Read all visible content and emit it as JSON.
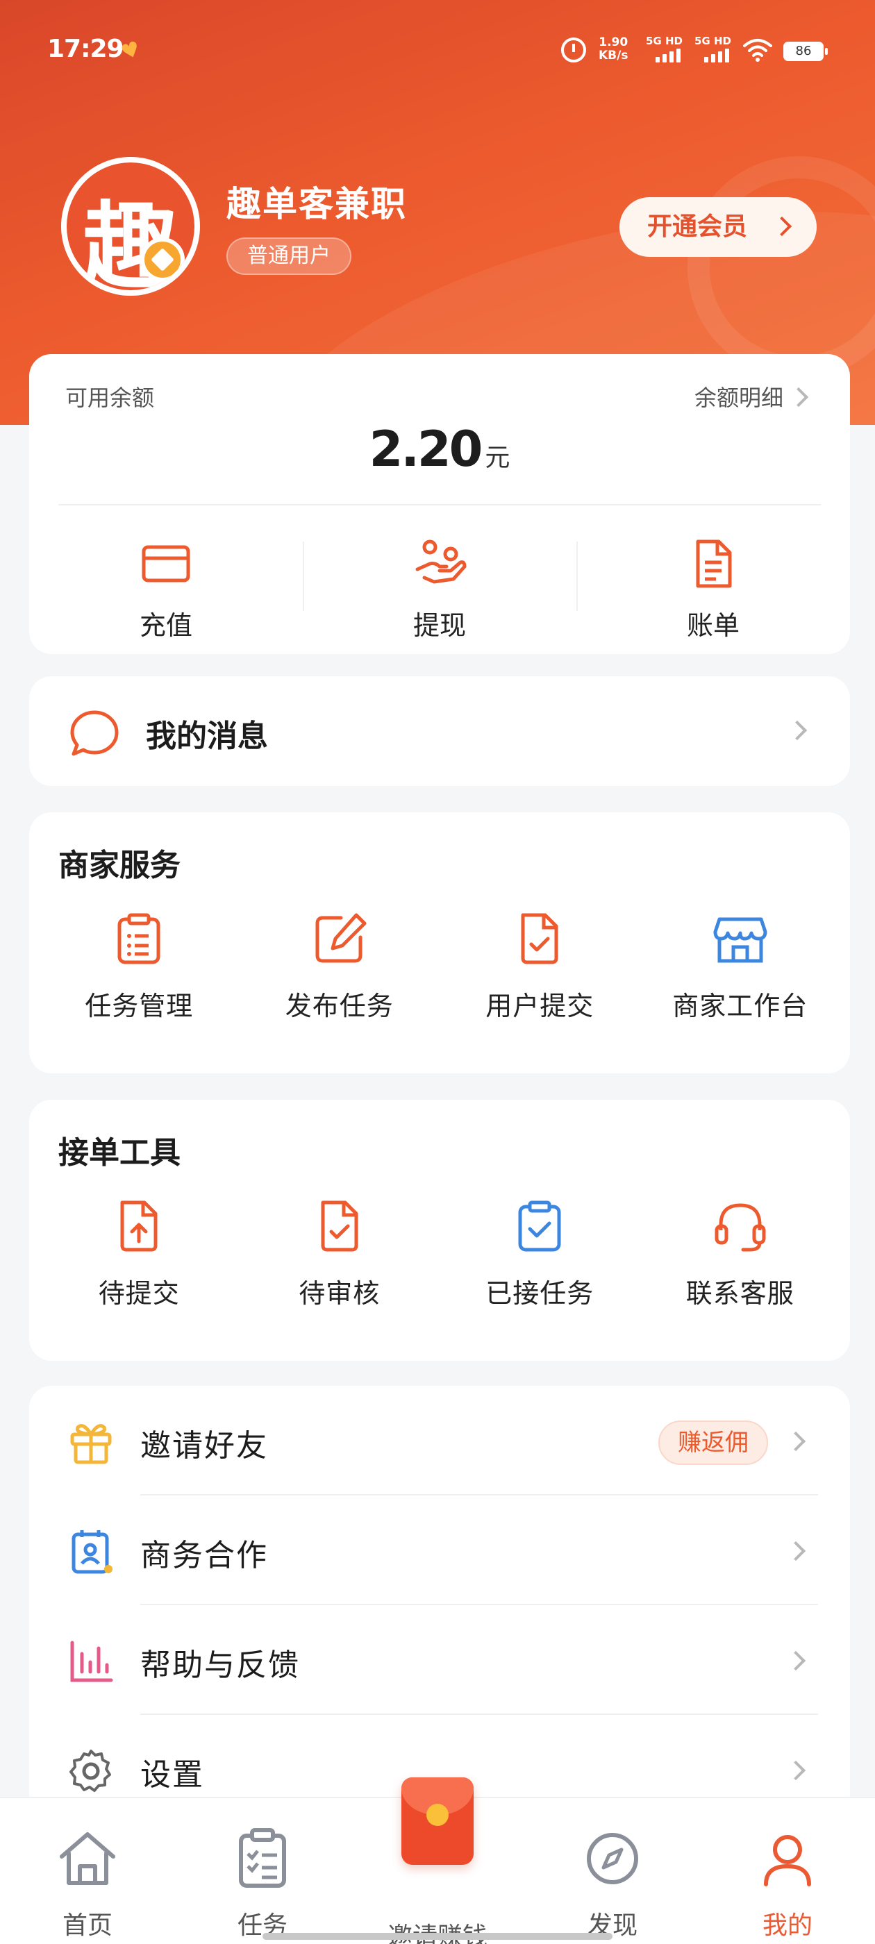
{
  "status_bar": {
    "time": "17:29",
    "speed_value": "1.90",
    "speed_unit": "KB/s",
    "net1": "5G HD",
    "net2": "5G HD",
    "battery": "86"
  },
  "profile": {
    "avatar_char": "趣",
    "name": "趣单客兼职",
    "tag": "普通用户",
    "vip_button": "开通会员"
  },
  "balance": {
    "label": "可用余额",
    "detail_link": "余额明细",
    "amount": "2.20",
    "unit": "元",
    "actions": [
      {
        "label": "充值",
        "icon": "card-icon"
      },
      {
        "label": "提现",
        "icon": "hand-coin-icon"
      },
      {
        "label": "账单",
        "icon": "document-icon"
      }
    ]
  },
  "messages": {
    "label": "我的消息"
  },
  "merchant_services": {
    "title": "商家服务",
    "items": [
      {
        "label": "任务管理",
        "icon": "clipboard-list-icon"
      },
      {
        "label": "发布任务",
        "icon": "edit-icon"
      },
      {
        "label": "用户提交",
        "icon": "file-check-icon"
      },
      {
        "label": "商家工作台",
        "icon": "store-icon"
      }
    ]
  },
  "order_tools": {
    "title": "接单工具",
    "items": [
      {
        "label": "待提交",
        "icon": "file-upload-icon"
      },
      {
        "label": "待审核",
        "icon": "file-check-icon"
      },
      {
        "label": "已接任务",
        "icon": "clipboard-check-icon"
      },
      {
        "label": "联系客服",
        "icon": "headset-icon"
      }
    ]
  },
  "menu": {
    "items": [
      {
        "label": "邀请好友",
        "badge": "赚返佣",
        "icon": "gift-icon"
      },
      {
        "label": "商务合作",
        "icon": "contact-card-icon"
      },
      {
        "label": "帮助与反馈",
        "icon": "bar-chart-icon"
      },
      {
        "label": "设置",
        "icon": "gear-icon"
      }
    ]
  },
  "tabbar": {
    "items": [
      {
        "label": "首页",
        "icon": "home-icon"
      },
      {
        "label": "任务",
        "icon": "task-list-icon"
      },
      {
        "label": "邀请赚钱",
        "icon": "red-packet-icon"
      },
      {
        "label": "发现",
        "icon": "compass-icon"
      },
      {
        "label": "我的",
        "icon": "user-icon"
      }
    ],
    "active": "我的"
  },
  "colors": {
    "brand": "#ec5a2e",
    "brand_dark": "#d9472a",
    "blue": "#3d86e0",
    "gift_yellow": "#f4b638",
    "pink": "#e45a8a"
  }
}
